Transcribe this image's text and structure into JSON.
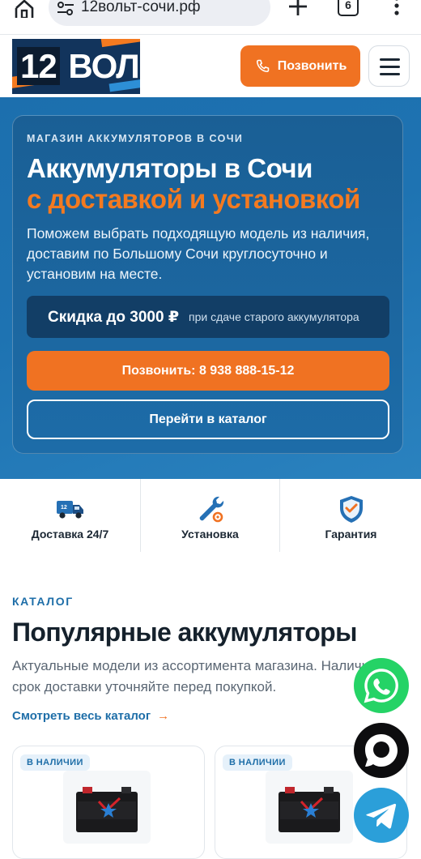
{
  "browser": {
    "url": "12вольт-сочи.рф",
    "tab_count": "6"
  },
  "header": {
    "logo_number": "12",
    "logo_word": "ВОЛЬТ",
    "call_label": "Позвонить"
  },
  "hero": {
    "eyebrow": "МАГАЗИН АККУМУЛЯТОРОВ В СОЧИ",
    "title": "Аккумуляторы в Сочи",
    "title_accent": "с доставкой и установкой",
    "description": "Поможем выбрать подходящую модель из наличия, доставим по Большому Сочи круглосуточно и установим на месте.",
    "discount_main": "Скидка до 3000 ₽",
    "discount_sub": "при сдаче старого аккумулятора",
    "call_button": "Позвонить: 8 938 888-15-12",
    "catalog_button": "Перейти в каталог"
  },
  "features": [
    {
      "label": "Доставка 24/7",
      "icon": "delivery-truck-icon"
    },
    {
      "label": "Установка",
      "icon": "wrench-icon"
    },
    {
      "label": "Гарантия",
      "icon": "shield-check-icon"
    }
  ],
  "catalog": {
    "eyebrow": "КАТАЛОГ",
    "title": "Популярные аккумуляторы",
    "description": "Актуальные модели из ассортимента магазина. Наличие и срок доставки уточняйте перед покупкой.",
    "view_all": "Смотреть весь каталог",
    "view_all_arrow": "→",
    "products": [
      {
        "badge": "В НАЛИЧИИ"
      },
      {
        "badge": "В НАЛИЧИИ"
      }
    ]
  },
  "colors": {
    "brand_orange": "#f07222",
    "brand_blue": "#1e6ea8",
    "hero_blue": "#1c6fae",
    "whatsapp": "#25d366",
    "telegram": "#2b9fd9"
  }
}
